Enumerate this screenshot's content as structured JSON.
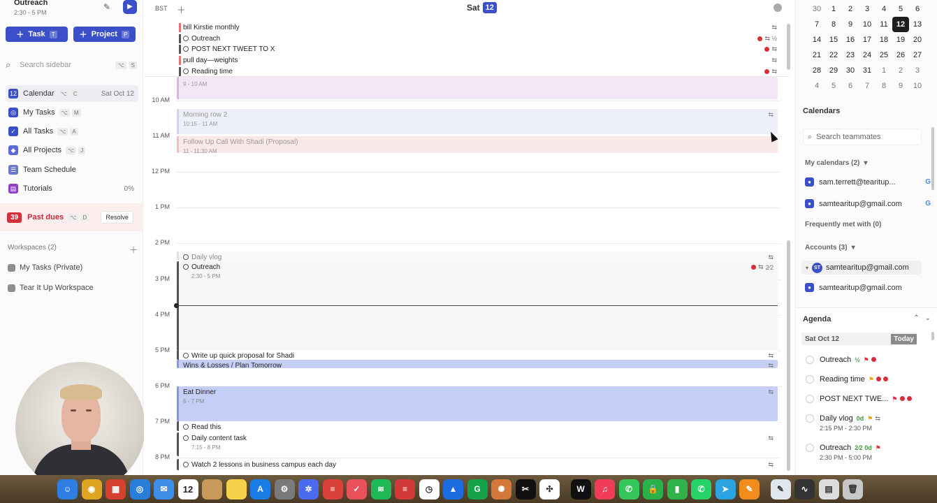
{
  "sidebar": {
    "current_event": {
      "title": "Outreach",
      "time": "2:30 - 5 PM"
    },
    "task_btn": {
      "label": "Task",
      "key": "T"
    },
    "project_btn": {
      "label": "Project",
      "key": "P"
    },
    "search": {
      "placeholder": "Search sidebar",
      "keys": [
        "⌥",
        "S"
      ]
    },
    "nav": [
      {
        "label": "Calendar",
        "keys": [
          "⌥",
          "C"
        ],
        "right": "Sat Oct 12",
        "color": "#3a4fc8"
      },
      {
        "label": "My Tasks",
        "keys": [
          "⌥",
          "M"
        ],
        "right": "",
        "color": "#3a4fc8"
      },
      {
        "label": "All Tasks",
        "keys": [
          "⌥",
          "A"
        ],
        "right": "",
        "color": "#3a4fc8"
      },
      {
        "label": "All Projects",
        "keys": [
          "⌥",
          "J"
        ],
        "right": "",
        "color": "#5a6ad6"
      },
      {
        "label": "Team Schedule",
        "keys": [],
        "right": "",
        "color": "#6b7ac8"
      },
      {
        "label": "Tutorials",
        "keys": [],
        "right": "0%",
        "color": "#8e3fc8"
      }
    ],
    "past_dues": {
      "count": "39",
      "label": "Past dues",
      "keys": [
        "⌥",
        "D"
      ],
      "action": "Resolve"
    },
    "workspaces": {
      "title": "Workspaces (2)",
      "items": [
        "My Tasks (Private)",
        "Tear It Up Workspace"
      ]
    }
  },
  "calendar": {
    "timezone": "BST",
    "day_name": "Sat",
    "day_num": "12",
    "all_day": [
      {
        "title": "bill Kirstie monthly",
        "bar": "#e57373",
        "circle": false,
        "icons": "⇆"
      },
      {
        "title": "Outreach",
        "bar": "#555555",
        "circle": true,
        "icons": "⇆ ½",
        "alert": true
      },
      {
        "title": "POST NEXT TWEET TO X",
        "bar": "#555555",
        "circle": true,
        "icons": "⇆",
        "alert": true
      },
      {
        "title": "pull day—weights",
        "bar": "#e57373",
        "circle": false,
        "icons": "⇆"
      },
      {
        "title": "Reading time",
        "bar": "#555555",
        "circle": true,
        "icons": "⇆",
        "alert": true
      }
    ],
    "hours": [
      "10 AM",
      "11 AM",
      "12 PM",
      "1 PM",
      "2 PM",
      "3 PM",
      "4 PM",
      "5 PM",
      "6 PM",
      "7 PM",
      "8 PM"
    ],
    "events": [
      {
        "title": "",
        "time": "9 - 10 AM",
        "bg": "#f1e2f6",
        "border": "#d8a5e6"
      },
      {
        "title": "Morning row 2",
        "time": "10:15 - 11 AM",
        "bg": "#eceef8",
        "border": "#c6cbee"
      },
      {
        "title": "Follow Up Call With Shadi (Proposal)",
        "time": "11 - 11:30 AM",
        "bg": "#fbe4e4",
        "border": "#f0b5b5"
      },
      {
        "title": "Daily vlog",
        "time": "",
        "bg": "#fafafa",
        "border": "#e0e0e0"
      },
      {
        "title": "Outreach",
        "time": "2:30 - 5 PM",
        "bg": "#f7f7f7",
        "border": "#555555"
      },
      {
        "title": "Write up quick proposal for Shadi",
        "time": "",
        "bg": "#ffffff",
        "border": "#555555"
      },
      {
        "title": "Wins & Losses / Plan Tomorrow",
        "time": "",
        "bg": "#c5cef5",
        "border": "#8896e6"
      },
      {
        "title": "Eat Dinner",
        "time": "6 - 7 PM",
        "bg": "#c5cef5",
        "border": "#8896e6"
      },
      {
        "title": "Read this",
        "time": "",
        "bg": "#ffffff",
        "border": "#555555"
      },
      {
        "title": "Daily content task",
        "time": "7:15 - 8 PM",
        "bg": "#ffffff",
        "border": "#555555"
      },
      {
        "title": "Watch 2 lessons in business campus each day",
        "time": "",
        "bg": "#ffffff",
        "border": "#555555"
      }
    ],
    "outreach_fraction": "2⁄2"
  },
  "mini_calendar": {
    "rows": [
      [
        "30",
        "1",
        "2",
        "3",
        "4",
        "5",
        "6"
      ],
      [
        "7",
        "8",
        "9",
        "10",
        "11",
        "12",
        "13"
      ],
      [
        "14",
        "15",
        "16",
        "17",
        "18",
        "19",
        "20"
      ],
      [
        "21",
        "22",
        "23",
        "24",
        "25",
        "26",
        "27"
      ],
      [
        "28",
        "29",
        "30",
        "31",
        "1",
        "2",
        "3"
      ],
      [
        "4",
        "5",
        "6",
        "7",
        "8",
        "9",
        "10"
      ]
    ],
    "today": "12"
  },
  "right_panel": {
    "calendars_title": "Calendars",
    "search_placeholder": "Search teammates",
    "my_calendars": "My calendars (2)",
    "calendar_items": [
      "sam.terrett@tearitup...",
      "samtearitup@gmail.com"
    ],
    "frequently_met": "Frequently met with (0)",
    "accounts": "Accounts (3)",
    "account_items": [
      "samtearitup@gmail.com",
      "samtearitup@gmail.com"
    ],
    "avatar_initials": "ST"
  },
  "agenda": {
    "title": "Agenda",
    "date": "Sat Oct 12",
    "today_label": "Today",
    "items": [
      {
        "title": "Outreach",
        "extra": "½",
        "time": ""
      },
      {
        "title": "Reading time",
        "extra": "",
        "time": ""
      },
      {
        "title": "POST NEXT TWE...",
        "extra": "",
        "time": ""
      },
      {
        "title": "Daily vlog",
        "extra": "0d",
        "time": "2:15 PM - 2:30 PM"
      },
      {
        "title": "Outreach",
        "extra": "2⁄2  0d",
        "time": "2:30 PM - 5:00 PM"
      }
    ]
  },
  "dock": {
    "apps": [
      "finder-icon",
      "chrome-icon",
      "launchpad-icon",
      "safari-icon",
      "mail-icon",
      "calendar-icon",
      "notes-icon",
      "stickies-icon",
      "appstore-icon",
      "settings-icon",
      "bluetooth-icon",
      "todoist-icon",
      "ticktick-icon",
      "spotify-icon",
      "tidal-icon",
      "clock-icon",
      "arc-icon",
      "grammarly-icon",
      "sunflower-icon",
      "capcut-icon",
      "chatgpt-icon",
      "wm-icon",
      "music-icon",
      "messages-icon",
      "lock-icon",
      "numbers-icon",
      "whatsapp-icon",
      "telegram-icon",
      "pages-icon",
      "script-icon",
      "audio-icon",
      "files-icon",
      "trash-icon"
    ],
    "colors": [
      "#2f7de1",
      "#e0a423",
      "#d6412f",
      "#2a7dd8",
      "#3f8fe8",
      "#ffffff",
      "#c69a5a",
      "#f6d24a",
      "#1c7ce6",
      "#7a7a7a",
      "#4a6af0",
      "#d9413a",
      "#e8505a",
      "#1db954",
      "#d23a3a",
      "#ffffff",
      "#1c6be0",
      "#15a34a",
      "#d4773a",
      "#111111",
      "#ffffff",
      "#111111",
      "#f23c57",
      "#35c759",
      "#2bb14a",
      "#2fb24a",
      "#25d366",
      "#2aa3e0",
      "#f28c1c",
      "#dfe6ee",
      "#333333",
      "#dddddd",
      "#c7c7c7"
    ],
    "calendar_date": "12"
  }
}
